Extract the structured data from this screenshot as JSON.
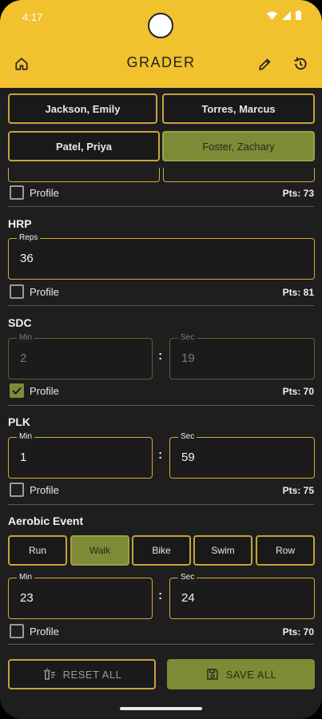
{
  "status_bar": {
    "time": "4:17"
  },
  "app_bar": {
    "title": "GRADER"
  },
  "soldiers": [
    {
      "name": "Jackson, Emily",
      "selected": false
    },
    {
      "name": "Torres, Marcus",
      "selected": false
    },
    {
      "name": "Patel, Priya",
      "selected": false
    },
    {
      "name": "Foster, Zachary",
      "selected": true
    }
  ],
  "events": {
    "first_partial": {
      "profile_label": "Profile",
      "profile_checked": false,
      "points": "Pts: 73"
    },
    "hrp": {
      "title": "HRP",
      "reps_label": "Reps",
      "reps_value": "36",
      "profile_label": "Profile",
      "profile_checked": false,
      "points": "Pts: 81"
    },
    "sdc": {
      "title": "SDC",
      "min_label": "Min",
      "min_value": "2",
      "sec_label": "Sec",
      "sec_value": "19",
      "separator": ":",
      "profile_label": "Profile",
      "profile_checked": true,
      "points": "Pts: 70"
    },
    "plk": {
      "title": "PLK",
      "min_label": "Min",
      "min_value": "1",
      "sec_label": "Sec",
      "sec_value": "59",
      "separator": ":",
      "profile_label": "Profile",
      "profile_checked": false,
      "points": "Pts: 75"
    },
    "aerobic": {
      "title": "Aerobic Event",
      "options": [
        {
          "label": "Run",
          "selected": false
        },
        {
          "label": "Walk",
          "selected": true
        },
        {
          "label": "Bike",
          "selected": false
        },
        {
          "label": "Swim",
          "selected": false
        },
        {
          "label": "Row",
          "selected": false
        }
      ],
      "min_label": "Min",
      "min_value": "23",
      "sec_label": "Sec",
      "sec_value": "24",
      "separator": ":",
      "profile_label": "Profile",
      "profile_checked": false,
      "points": "Pts: 70"
    }
  },
  "actions": {
    "reset_label": "RESET ALL",
    "save_label": "SAVE ALL"
  },
  "colors": {
    "accent": "#f2c12e",
    "selected": "#7e8a36",
    "border": "#c8a23a",
    "background": "#1e1e1e"
  },
  "icons": [
    "home-icon",
    "pencil-icon",
    "history-icon",
    "wifi-icon",
    "signal-icon",
    "battery-icon",
    "check-icon",
    "reset-icon",
    "save-icon"
  ]
}
